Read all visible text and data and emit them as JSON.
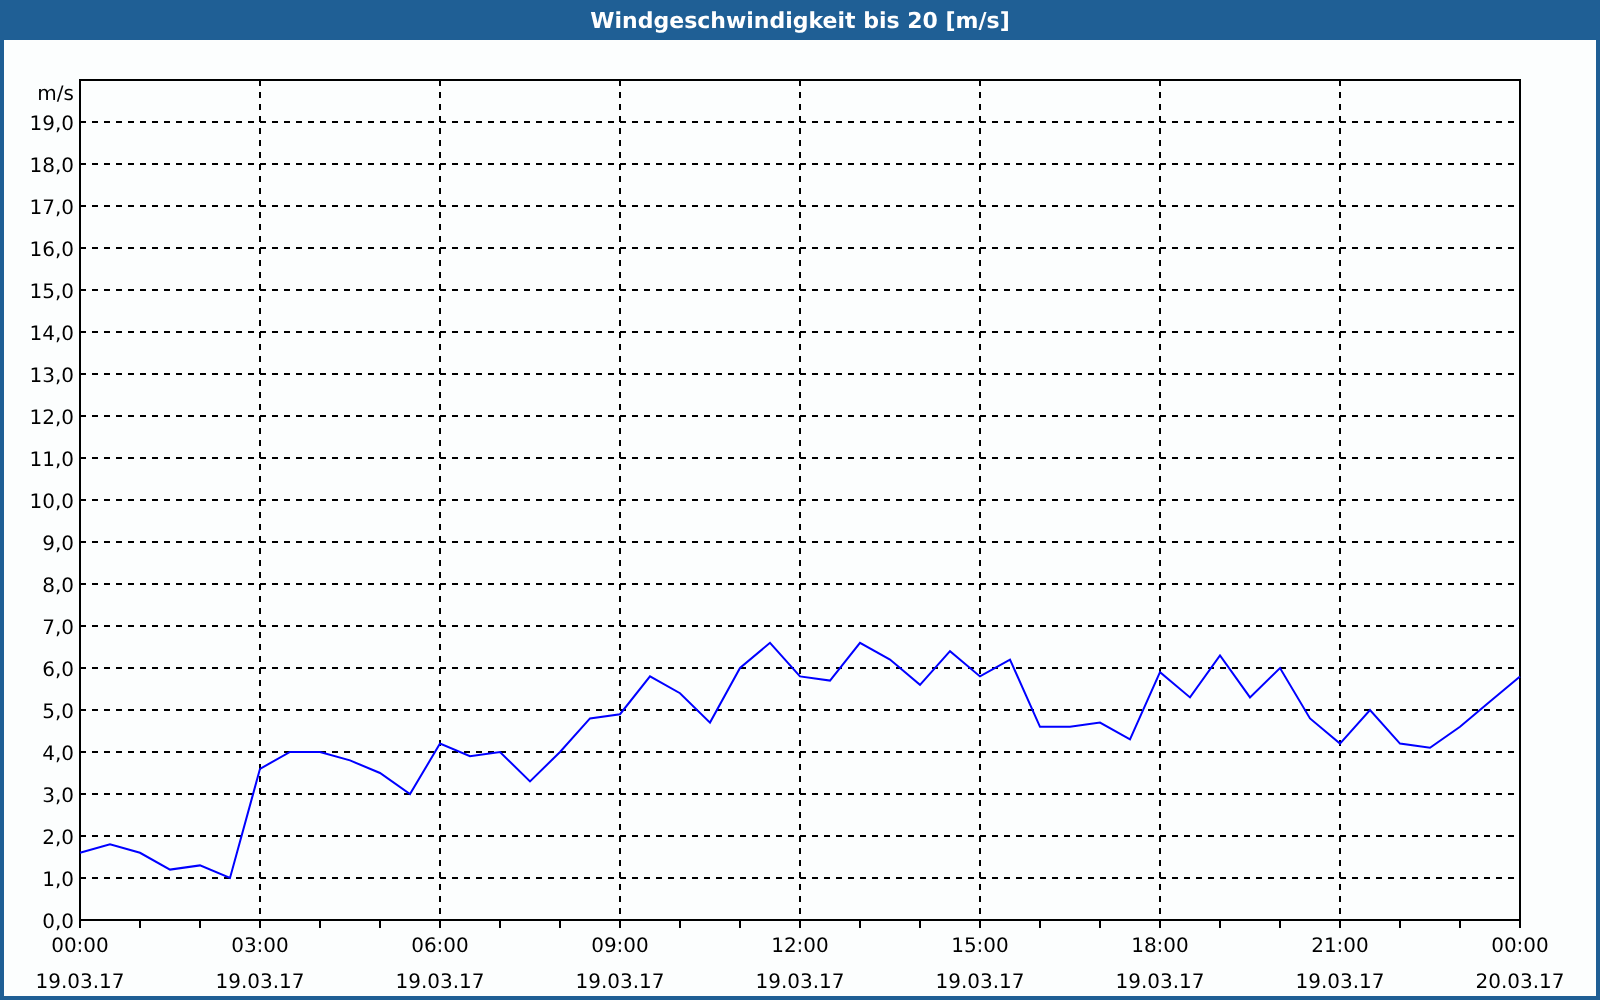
{
  "window": {
    "title": "Windgeschwindigkeit bis 20 [m/s]"
  },
  "chart": {
    "date_labels": [
      "19.03.17",
      "19.03.17",
      "19.03.17",
      "19.03.17",
      "19.03.17",
      "19.03.17",
      "19.03.17",
      "19.03.17",
      "20.03.17"
    ],
    "chart_data": {
      "type": "line",
      "ylabel": "m/s",
      "xlim": [
        0,
        24
      ],
      "ylim": [
        0,
        20
      ],
      "x": [
        0,
        0.5,
        1,
        1.5,
        2,
        2.5,
        3,
        3.5,
        4,
        4.5,
        5,
        5.5,
        6,
        6.5,
        7,
        7.5,
        8,
        8.5,
        9,
        9.5,
        10,
        10.5,
        11,
        11.5,
        12,
        12.5,
        13,
        13.5,
        14,
        14.5,
        15,
        15.5,
        16,
        16.5,
        17,
        17.5,
        18,
        18.5,
        19,
        19.5,
        20,
        20.5,
        21,
        21.5,
        22,
        22.5,
        23,
        23.5,
        24
      ],
      "grid": true,
      "series": [
        {
          "color": "#0000ff",
          "values": [
            1.6,
            1.8,
            1.6,
            1.2,
            1.3,
            1.0,
            3.6,
            4.0,
            4.0,
            3.8,
            3.5,
            3.0,
            4.2,
            3.9,
            4.0,
            3.3,
            4.0,
            4.8,
            4.9,
            5.8,
            5.4,
            4.7,
            6.0,
            6.6,
            5.8,
            5.7,
            6.6,
            6.2,
            5.6,
            6.4,
            5.8,
            6.2,
            4.6,
            4.6,
            4.7,
            4.3,
            5.9,
            5.3,
            6.3,
            5.3,
            6.0,
            4.8,
            4.2,
            5.0,
            4.2,
            4.1,
            4.6,
            5.2,
            5.8
          ]
        }
      ],
      "xticks": [
        {
          "value": 0,
          "label": "00:00"
        },
        {
          "value": 3,
          "label": "03:00"
        },
        {
          "value": 6,
          "label": "06:00"
        },
        {
          "value": 9,
          "label": "09:00"
        },
        {
          "value": 12,
          "label": "12:00"
        },
        {
          "value": 15,
          "label": "15:00"
        },
        {
          "value": 18,
          "label": "18:00"
        },
        {
          "value": 21,
          "label": "21:00"
        },
        {
          "value": 24,
          "label": "00:00"
        }
      ],
      "yticks": [
        {
          "value": 0,
          "label": "0,0"
        },
        {
          "value": 1,
          "label": "1,0"
        },
        {
          "value": 2,
          "label": "2,0"
        },
        {
          "value": 3,
          "label": "3,0"
        },
        {
          "value": 4,
          "label": "4,0"
        },
        {
          "value": 5,
          "label": "5,0"
        },
        {
          "value": 6,
          "label": "6,0"
        },
        {
          "value": 7,
          "label": "7,0"
        },
        {
          "value": 8,
          "label": "8,0"
        },
        {
          "value": 9,
          "label": "9,0"
        },
        {
          "value": 10,
          "label": "10,0"
        },
        {
          "value": 11,
          "label": "11,0"
        },
        {
          "value": 12,
          "label": "12,0"
        },
        {
          "value": 13,
          "label": "13,0"
        },
        {
          "value": 14,
          "label": "14,0"
        },
        {
          "value": 15,
          "label": "15,0"
        },
        {
          "value": 16,
          "label": "16,0"
        },
        {
          "value": 17,
          "label": "17,0"
        },
        {
          "value": 18,
          "label": "18,0"
        },
        {
          "value": 19,
          "label": "19,0"
        }
      ]
    }
  }
}
